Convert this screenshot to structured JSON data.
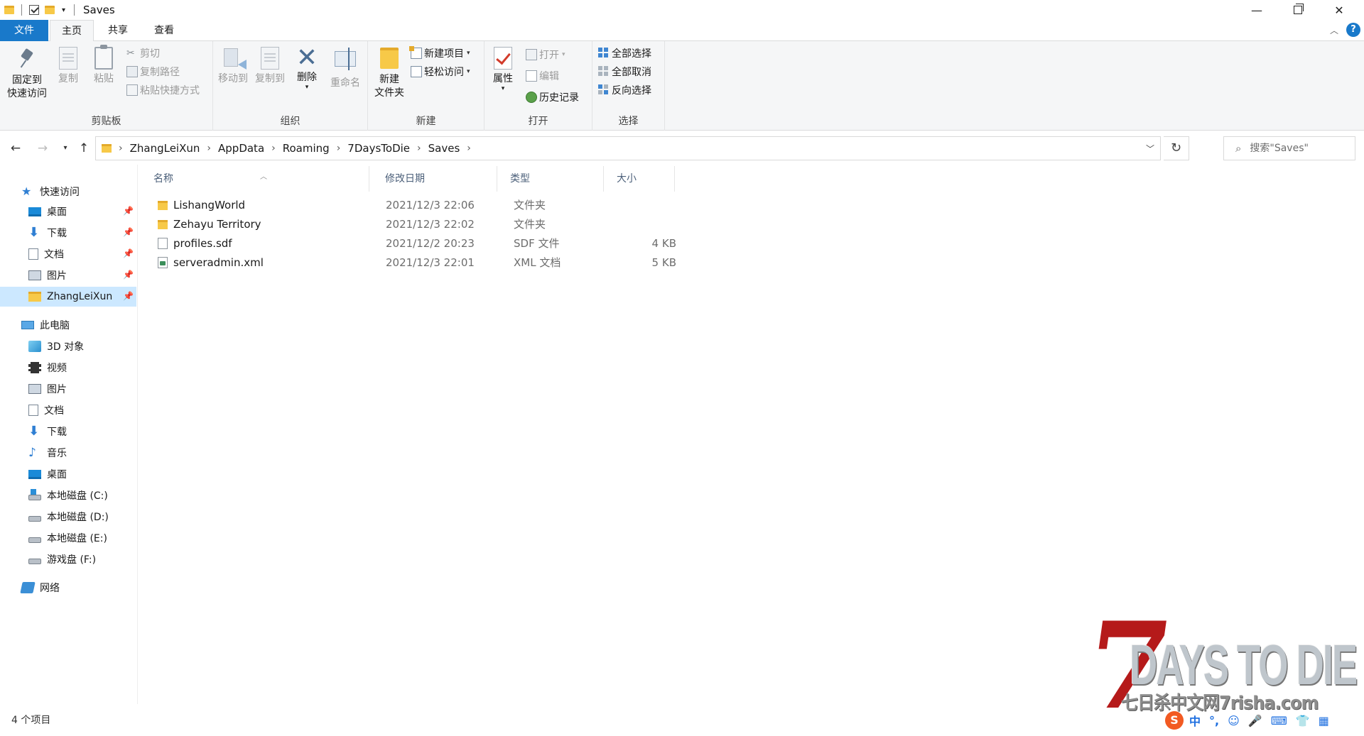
{
  "window": {
    "title": "Saves"
  },
  "quick_access_toolbar": {
    "dropdown": "▾"
  },
  "window_controls": {
    "minimize": "—",
    "maximize": "",
    "close": "✕"
  },
  "ribbon_tabs": {
    "file": "文件",
    "home": "主页",
    "share": "共享",
    "view": "查看",
    "help": "?"
  },
  "ribbon": {
    "clipboard": {
      "label": "剪贴板",
      "pin_quick_access": "固定到\n快速访问",
      "copy": "复制",
      "paste": "粘贴",
      "cut": "剪切",
      "copy_path": "复制路径",
      "paste_shortcut": "粘贴快捷方式"
    },
    "organize": {
      "label": "组织",
      "move_to": "移动到",
      "copy_to": "复制到",
      "delete": "删除",
      "rename": "重命名"
    },
    "new": {
      "label": "新建",
      "new_folder": "新建\n文件夹",
      "new_item": "新建项目",
      "easy_access": "轻松访问"
    },
    "open": {
      "label": "打开",
      "properties": "属性",
      "open": "打开",
      "edit": "编辑",
      "history": "历史记录"
    },
    "select": {
      "label": "选择",
      "select_all": "全部选择",
      "select_none": "全部取消",
      "invert_selection": "反向选择"
    }
  },
  "address": {
    "crumbs": [
      "ZhangLeiXun",
      "AppData",
      "Roaming",
      "7DaysToDie",
      "Saves"
    ],
    "sep": "›",
    "search_placeholder": "搜索\"Saves\""
  },
  "nav_pane": {
    "quick_access": "快速访问",
    "quick_items": [
      "桌面",
      "下载",
      "文档",
      "图片",
      "ZhangLeiXun"
    ],
    "this_pc": "此电脑",
    "pc_items": [
      "3D 对象",
      "视频",
      "图片",
      "文档",
      "下载",
      "音乐",
      "桌面",
      "本地磁盘 (C:)",
      "本地磁盘 (D:)",
      "本地磁盘 (E:)",
      "游戏盘 (F:)"
    ],
    "network": "网络"
  },
  "columns": {
    "name": "名称",
    "date": "修改日期",
    "type": "类型",
    "size": "大小"
  },
  "files": [
    {
      "name": "LishangWorld",
      "date": "2021/12/3 22:06",
      "type": "文件夹",
      "size": ""
    },
    {
      "name": "Zehayu Territory",
      "date": "2021/12/3 22:02",
      "type": "文件夹",
      "size": ""
    },
    {
      "name": "profiles.sdf",
      "date": "2021/12/2 20:23",
      "type": "SDF 文件",
      "size": "4 KB"
    },
    {
      "name": "serveradmin.xml",
      "date": "2021/12/3 22:01",
      "type": "XML 文档",
      "size": "5 KB"
    }
  ],
  "status": {
    "item_count": "4 个项目"
  },
  "watermark": {
    "seven": "7",
    "title": "DAYS TO DIE",
    "subtitle": "七日杀中文网7risha.com"
  },
  "ime": {
    "logo": "S",
    "mode": "中",
    "punct": "°,",
    "items": [
      "☺",
      "🎤",
      "⌨",
      "👕",
      "▦"
    ]
  }
}
